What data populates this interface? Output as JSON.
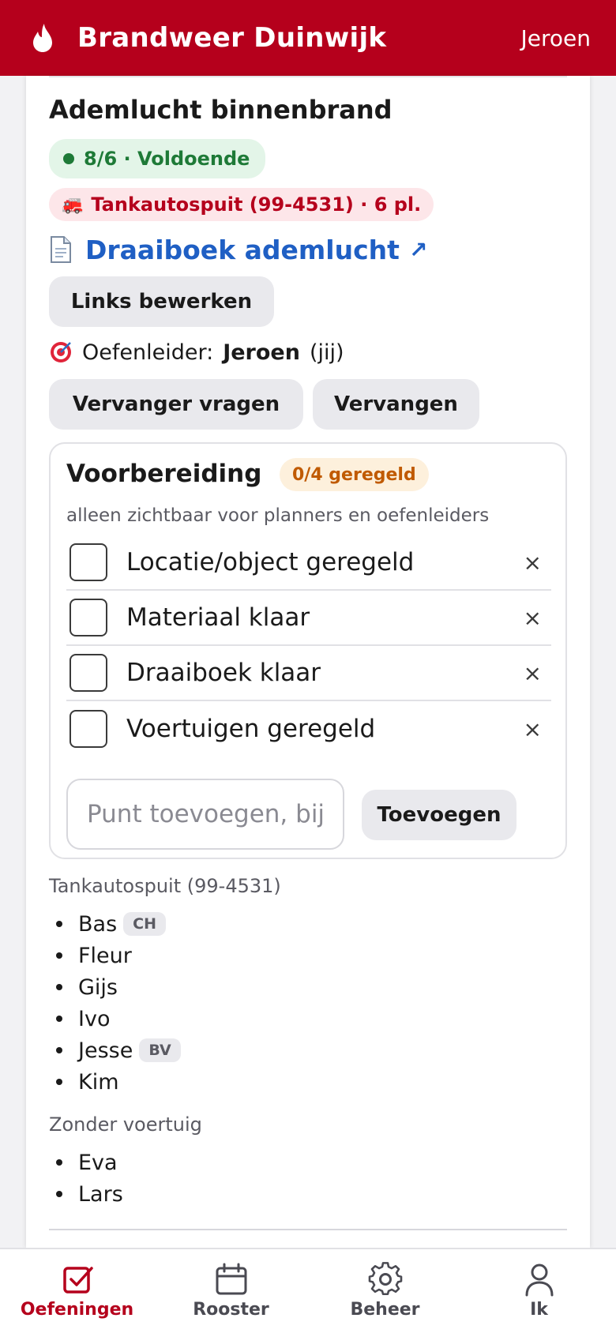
{
  "header": {
    "app_title": "Brandweer Duinwijk",
    "user": "Jeroen",
    "brand_color": "#b5001c"
  },
  "exercise": {
    "title": "Ademlucht binnenbrand",
    "status": "8/6 · Voldoende",
    "vehicle": "Tankautospuit (99-4531) · 6 pl.",
    "doc_link": "Draaiboek ademlucht",
    "doc_link_arrow": "↗",
    "edit_links_label": "Links bewerken",
    "leader_label": "Oefenleider:",
    "leader_name": "Jeroen",
    "leader_suffix": "(jij)",
    "ask_replacement_label": "Vervanger vragen",
    "replace_label": "Vervangen"
  },
  "preparation": {
    "title": "Voorbereiding",
    "badge": "0/4 geregeld",
    "subtitle": "alleen zichtbaar voor planners en oefenleiders",
    "items": [
      {
        "label": "Locatie/object geregeld",
        "checked": false
      },
      {
        "label": "Materiaal klaar",
        "checked": false
      },
      {
        "label": "Draaiboek klaar",
        "checked": false
      },
      {
        "label": "Voertuigen geregeld",
        "checked": false
      }
    ],
    "remove_glyph": "×",
    "input_placeholder": "Punt toevoegen, bijv",
    "add_label": "Toevoegen"
  },
  "crew": {
    "vehicle_group": "Tankautospuit (99-4531)",
    "vehicle_members": [
      {
        "name": "Bas",
        "role": "CH"
      },
      {
        "name": "Fleur",
        "role": ""
      },
      {
        "name": "Gijs",
        "role": ""
      },
      {
        "name": "Ivo",
        "role": ""
      },
      {
        "name": "Jesse",
        "role": "BV"
      },
      {
        "name": "Kim",
        "role": ""
      }
    ],
    "no_vehicle_group": "Zonder voertuig",
    "no_vehicle_members": [
      {
        "name": "Eva"
      },
      {
        "name": "Lars"
      }
    ]
  },
  "nav": {
    "items": [
      {
        "label": "Oefeningen",
        "icon": "checkbox-icon",
        "active": true
      },
      {
        "label": "Rooster",
        "icon": "calendar-icon",
        "active": false
      },
      {
        "label": "Beheer",
        "icon": "gear-icon",
        "active": false
      },
      {
        "label": "Ik",
        "icon": "person-icon",
        "active": false
      }
    ]
  }
}
